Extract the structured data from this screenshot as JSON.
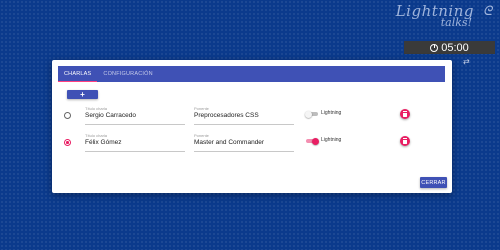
{
  "brand": {
    "line1": "Lightning",
    "line2": "talks!"
  },
  "timer": {
    "value": "05:00",
    "icon": "clock-icon"
  },
  "reset": {
    "icon": "refresh-icon"
  },
  "tabs": [
    {
      "label": "CHARLAS",
      "active": true
    },
    {
      "label": "CONFIGURACIÓN",
      "active": false
    }
  ],
  "add_button": {
    "label": "+"
  },
  "talks": [
    {
      "title_label": "Título charla",
      "title": "Sergio Carracedo",
      "speaker_label": "Ponente",
      "speaker": "Preprocesadores CSS",
      "lightning_label": "Lightning",
      "lightning": false,
      "selected": false
    },
    {
      "title_label": "Título charla",
      "title": "Félix Gómez",
      "speaker_label": "Ponente",
      "speaker": "Master and Commander",
      "lightning_label": "Lightning",
      "lightning": true,
      "selected": true
    }
  ],
  "close_button": {
    "label": "CERRAR"
  },
  "colors": {
    "background": "#0b3a8c",
    "primary": "#3f51b5",
    "accent": "#e91e63",
    "timer_bg": "#3a3a3a"
  }
}
